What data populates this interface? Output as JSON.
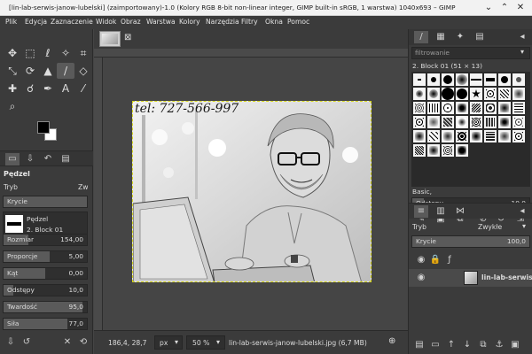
{
  "window": {
    "title": "[lin-lab-serwis-janow-lubelski] (zaimportowany)-1.0 (Kolory RGB 8-bit non-linear integer, GIMP built-in sRGB, 1 warstwa) 1040x693 – GIMP",
    "minimize": "⌄",
    "maximize": "⌃",
    "close": "✕"
  },
  "menu": [
    "Plik",
    "Edycja",
    "Zaznaczenie",
    "Widok",
    "Obraz",
    "Warstwa",
    "Kolory",
    "Narzędzia",
    "Filtry",
    "Okna",
    "Pomoc"
  ],
  "tabs": {
    "close": "⊠"
  },
  "left_panel": {
    "title": "Pędzel",
    "mode_label": "Tryb",
    "mode_value": "Zw",
    "opacity_label": "Krycie",
    "brush_name": "Pędzel",
    "brush_value": "2. Block 01",
    "sliders": [
      {
        "label": "Rozmiar",
        "value": "154,00",
        "fill": 0.3
      },
      {
        "label": "Proporcje",
        "value": "5,00",
        "fill": 0.55
      },
      {
        "label": "Kąt",
        "value": "0,00",
        "fill": 0.5
      },
      {
        "label": "Odstępy",
        "value": "10,0",
        "fill": 0.12
      },
      {
        "label": "Twardość",
        "value": "95,0",
        "fill": 0.95
      },
      {
        "label": "Siła",
        "value": "77,0",
        "fill": 0.77
      }
    ]
  },
  "canvas": {
    "overlay_text": "tel: 727-566-997"
  },
  "statusbar": {
    "coords": "186,4, 28,7",
    "unit": "px",
    "zoom": "50 %",
    "file": "lin-lab-serwis-janow-lubelski.jpg (6,7 MB)"
  },
  "brushes_panel": {
    "filter_placeholder": "filtrowanie",
    "selected": "2. Block 01 (51 × 13)",
    "tag": "Basic,",
    "spacing_label": "Odstępy",
    "spacing_value": "10,0"
  },
  "layers_panel": {
    "mode_label": "Tryb",
    "mode_value": "Zwykłe",
    "opacity_label": "Krycie",
    "opacity_value": "100,0",
    "layer_name": "lin-lab-serwis"
  },
  "colors": {
    "bg": "#454545",
    "panel": "#3b3b3b",
    "accent": "#5a5a5a"
  }
}
